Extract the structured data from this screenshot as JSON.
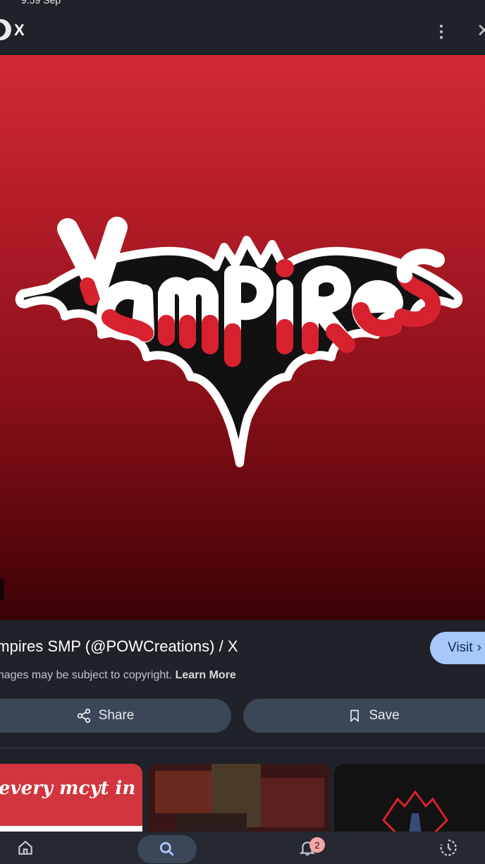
{
  "status_bar": {
    "time": "9:59 Sep",
    "signal": ""
  },
  "app_bar": {
    "title": "X"
  },
  "image": {
    "logo_text": "Vampires",
    "colors": {
      "background_top": "#d12a35",
      "background_bottom": "#3b0206",
      "bat": "#111111",
      "outline": "#ffffff",
      "letters": "#ffffff",
      "drip": "#d8212f"
    }
  },
  "result": {
    "title": "Vampires SMP (@POWCreations) / X",
    "visit_label": "Visit",
    "copyright_text": "Images may be subject to copyright.",
    "learn_more_label": "Learn More"
  },
  "actions": {
    "share_label": "Share",
    "save_label": "Save"
  },
  "related": {
    "thumb1_text": "every mcyt in"
  },
  "bottom_nav": {
    "notification_count": "2",
    "accent": "#3c4659"
  }
}
